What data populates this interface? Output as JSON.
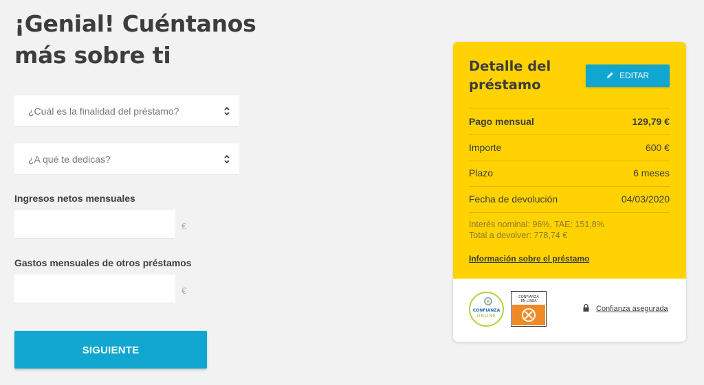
{
  "header": {
    "title": "¡Genial! Cuéntanos más sobre ti"
  },
  "form": {
    "purpose_select": {
      "placeholder": "¿Cuál es la finalidad del préstamo?"
    },
    "occupation_select": {
      "placeholder": "¿A qué te dedicas?"
    },
    "income": {
      "label": "Ingresos netos mensuales",
      "value": "",
      "currency": "€"
    },
    "expenses": {
      "label": "Gastos mensuales de otros préstamos",
      "value": "",
      "currency": "€"
    },
    "next_label": "SIGUIENTE"
  },
  "loan_card": {
    "title": "Detalle del préstamo",
    "edit_label": "EDITAR",
    "rows": [
      {
        "label": "Pago mensual",
        "value": "129,79 €"
      },
      {
        "label": "Importe",
        "value": "600 €"
      },
      {
        "label": "Plazo",
        "value": "6 meses"
      },
      {
        "label": "Fecha de devolución",
        "value": "04/03/2020"
      }
    ],
    "interest_text": "Interés nominal: 96%, TAE: 151,8%",
    "total_text": "Total a devolver: 778,74 €",
    "info_link": "Información sobre el préstamo",
    "seals": {
      "round_top": "CONFIANZA",
      "round_bottom": "ONLINE",
      "square_line1": "CONFIANZA",
      "square_line2": "EN LINEA"
    },
    "trust_link": "Confianza asegurada"
  },
  "colors": {
    "accent_blue": "#10a6cf",
    "card_yellow": "#ffd200",
    "background": "#f2f2f2",
    "seal_orange": "#f08a24",
    "seal_green": "#b7cf3b"
  },
  "icons": [
    "chevron-updown-icon",
    "pencil-icon",
    "lock-icon"
  ]
}
